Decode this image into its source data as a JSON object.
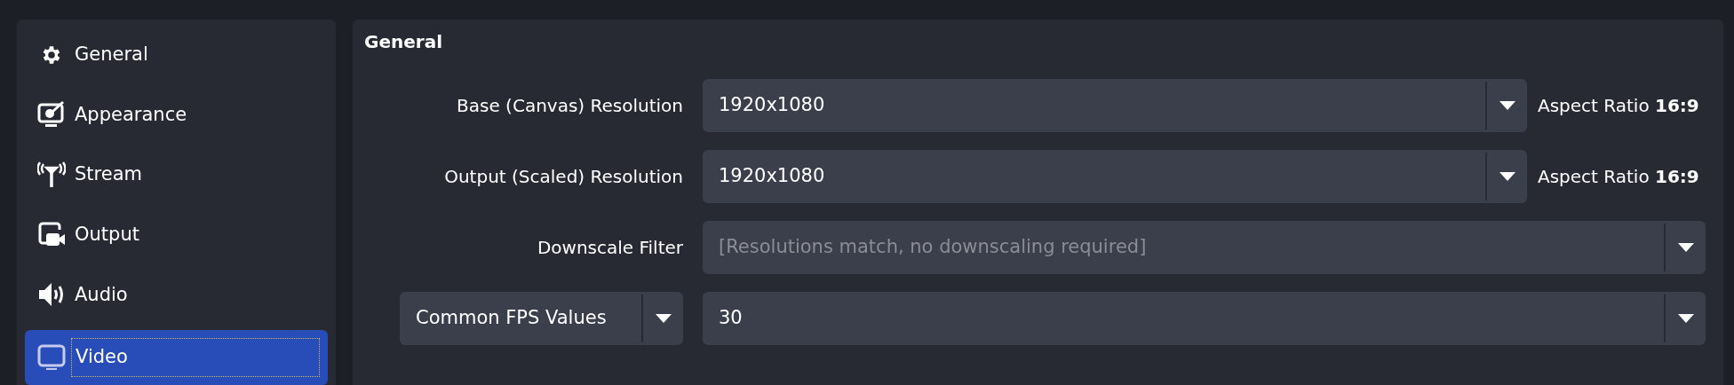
{
  "sidebar": {
    "items": [
      {
        "label": "General",
        "selected": false
      },
      {
        "label": "Appearance",
        "selected": false
      },
      {
        "label": "Stream",
        "selected": false
      },
      {
        "label": "Output",
        "selected": false
      },
      {
        "label": "Audio",
        "selected": false
      },
      {
        "label": "Video",
        "selected": true
      }
    ]
  },
  "section": {
    "title": "General",
    "rows": [
      {
        "kind": "resolution",
        "label": "Base (Canvas) Resolution",
        "value": "1920x1080",
        "note": "Aspect Ratio **16:9**"
      },
      {
        "kind": "resolution",
        "label": "Output (Scaled) Resolution",
        "value": "1920x1080",
        "note": "Aspect Ratio **16:9**"
      },
      {
        "kind": "filter",
        "label": "Downscale Filter",
        "value": "[Resolutions match, no downscaling required]",
        "disabled": true
      },
      {
        "kind": "fps",
        "mode": "Common FPS Values",
        "value": "30"
      }
    ]
  }
}
